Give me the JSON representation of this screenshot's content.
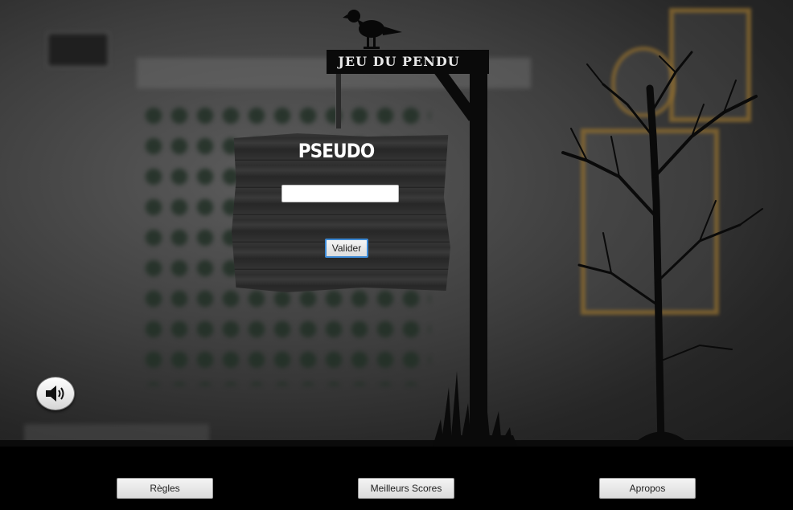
{
  "game": {
    "title": "JEU DU PENDU"
  },
  "login": {
    "heading": "PSEUDO",
    "pseudo_value": "",
    "submit_label": "Valider"
  },
  "bottom_menu": {
    "rules_label": "Règles",
    "scores_label": "Meilleurs Scores",
    "about_label": "Apropos"
  },
  "icons": {
    "sound": "speaker-volume-icon",
    "crow": "crow-icon",
    "tree": "dead-tree",
    "gallows": "gallows"
  },
  "colors": {
    "background": "#3e3e3e",
    "sign_wood": "#303030",
    "focus_accent": "#3d8ad6",
    "frame_gold": "#8a6a30",
    "bottom_bar": "#000000"
  }
}
